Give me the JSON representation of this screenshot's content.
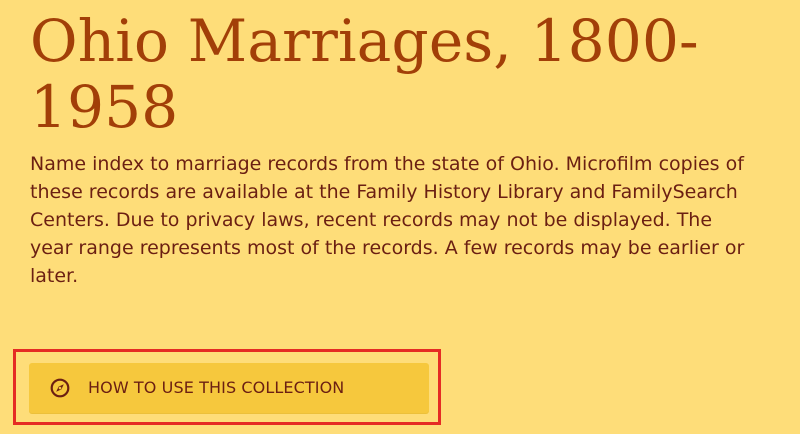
{
  "collection": {
    "title": "Ohio Marriages, 1800-1958",
    "description": "Name index to marriage records from the state of Ohio. Microfilm copies of these records are available at the Family History Library and FamilySearch Centers. Due to privacy laws, recent records may not be displayed. The year range represents most of the records. A few records may be earlier or later.",
    "button": {
      "label": "HOW TO USE THIS COLLECTION",
      "icon": "compass-icon"
    }
  },
  "colors": {
    "background": "#fedd79",
    "title": "#a23f08",
    "text": "#6b1f12",
    "button_background": "#f6c83d",
    "highlight_border": "#e52b24"
  }
}
